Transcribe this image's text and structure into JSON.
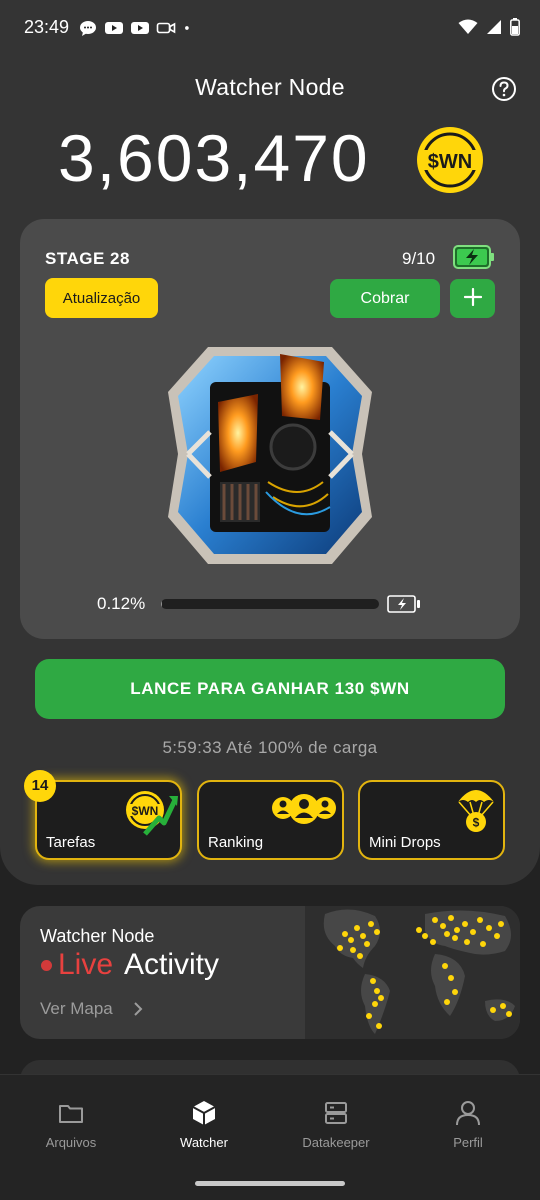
{
  "status_bar": {
    "time": "23:49",
    "left_icons": [
      "chat-bubble-icon",
      "youtube-icon",
      "youtube-icon",
      "video-camera-icon",
      "dot-icon"
    ],
    "right_icons": [
      "wifi-icon",
      "cell-signal-icon",
      "battery-icon"
    ]
  },
  "header": {
    "title": "Watcher Node",
    "help_icon": "help-circle-icon"
  },
  "balance": {
    "amount": "3,603,470",
    "token_label": "$WN",
    "token_color": "#ffd60a"
  },
  "stage_card": {
    "stage_label": "STAGE 28",
    "capacity": "9/10",
    "capacity_icon": "battery-charging-icon",
    "update_label": "Atualização",
    "collect_label": "Cobrar",
    "plus_label": "+",
    "machine_image": "watcher-node-reactor-image",
    "progress_text": "0.12%",
    "progress_fraction": 0.0012,
    "charge_icon": "battery-bolt-icon"
  },
  "launch_button": {
    "label": "LANCE PARA GANHAR 130 $WN",
    "color": "#2fa943"
  },
  "charge_timer": "5:59:33 Até 100% de carga",
  "tiles": [
    {
      "label": "Tarefas",
      "badge": "14",
      "icon": "wn-coin-arrow-icon",
      "coin_text": "$WN"
    },
    {
      "label": "Ranking",
      "icon": "users-group-icon"
    },
    {
      "label": "Mini Drops",
      "icon": "parachute-coin-icon",
      "coin_text": "$"
    }
  ],
  "live_card": {
    "title": "Watcher Node",
    "live_word": "Live",
    "activity_word": "Activity",
    "map_link": "Ver Mapa",
    "map_icon": "world-map-icon"
  },
  "bottom_nav": [
    {
      "label": "Arquivos",
      "icon": "folder-icon",
      "active": false
    },
    {
      "label": "Watcher",
      "icon": "cube-icon",
      "active": true
    },
    {
      "label": "Datakeeper",
      "icon": "server-icon",
      "active": false
    },
    {
      "label": "Perfil",
      "icon": "user-icon",
      "active": false
    }
  ],
  "colors": {
    "accent_yellow": "#ffd60a",
    "accent_green": "#2fa943",
    "live_red": "#e8413f",
    "background": "#222222",
    "panel": "#343434"
  }
}
